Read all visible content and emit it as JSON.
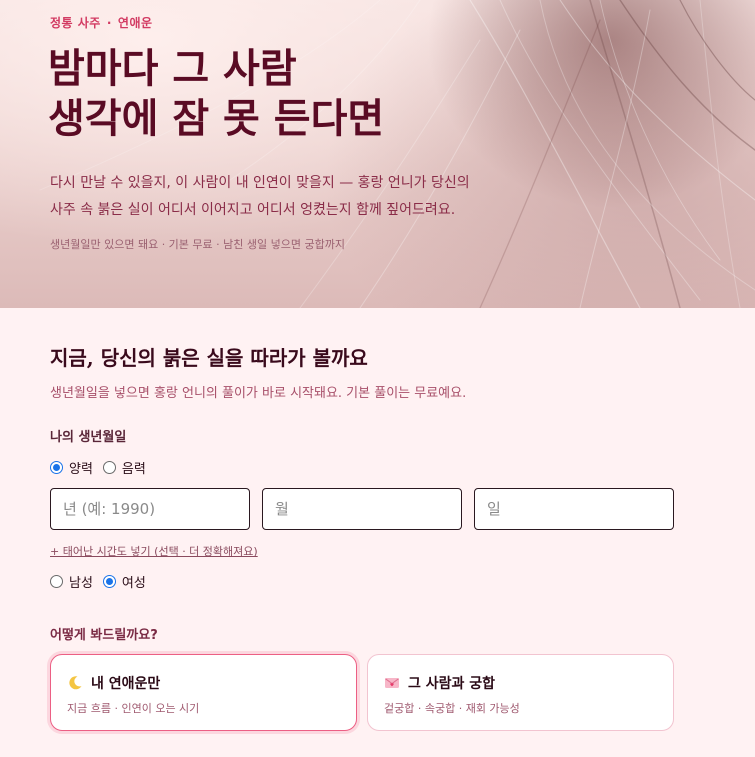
{
  "hero": {
    "eyebrow_left": "정통 사주",
    "eyebrow_sep": "·",
    "eyebrow_right": "연애운",
    "title_line1": "밤마다 그 사람",
    "title_line2": "생각에 잠 못 든다면",
    "desc_line1": "다시 만날 수 있을지, 이 사람이 내 인연이 맞을지 — 홍랑 언니가 당신의",
    "desc_line2": "사주 속 붉은 실이 어디서 이어지고 어디서 엉켰는지 함께 짚어드려요.",
    "note": "생년월일만 있으면 돼요 · 기본 무료 · 남친 생일 넣으면 궁합까지"
  },
  "form": {
    "title": "지금, 당신의 붉은 실을 따라가 볼까요",
    "subtitle": "생년월일을 넣으면 홍랑 언니의 풀이가 바로 시작돼요. 기본 풀이는 무료예요.",
    "birth_label": "나의 생년월일",
    "calendar": {
      "solar": "양력",
      "lunar": "음력",
      "selected": "양력"
    },
    "year_placeholder": "년 (예: 1990)",
    "month_placeholder": "월",
    "day_placeholder": "일",
    "time_link": "+ 태어난 시간도 넣기 (선택 · 더 정확해져요)",
    "gender": {
      "male": "남성",
      "female": "여성",
      "selected": "여성"
    },
    "how_label": "어떻게 봐드릴까요?",
    "options": [
      {
        "icon": "crescent-moon-icon",
        "title": "내 연애운만",
        "sub": "지금 흐름 · 인연이 오는 시기",
        "selected": true
      },
      {
        "icon": "love-letter-icon",
        "title": "그 사람과 궁합",
        "sub": "겉궁합 · 속궁합 · 재회 가능성",
        "selected": false
      }
    ]
  },
  "colors": {
    "accent": "#ec5f84",
    "title": "#5a0b24",
    "eyebrow": "#d23a62",
    "radio": "#1a73e8"
  }
}
